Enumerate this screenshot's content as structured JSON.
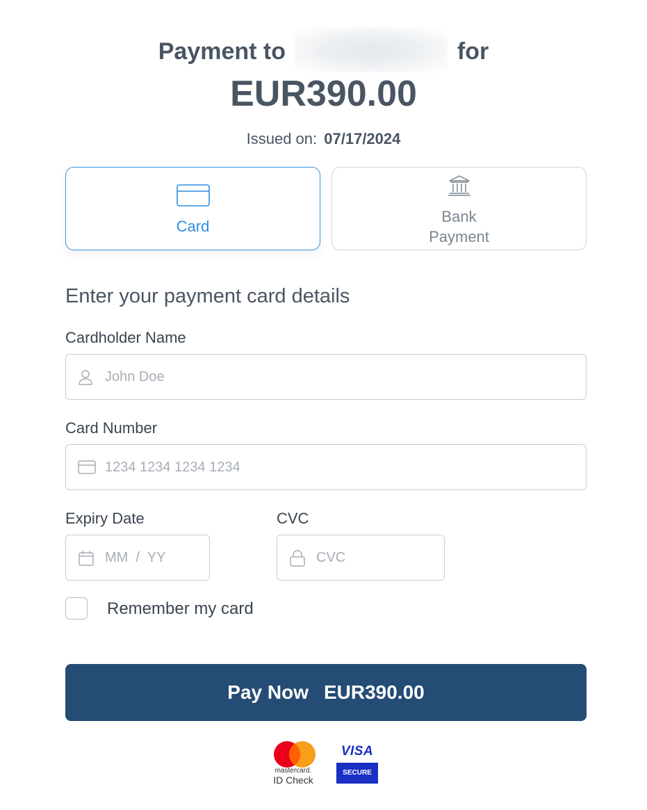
{
  "header": {
    "title_prefix": "Payment to",
    "title_suffix": "for",
    "amount": "EUR390.00",
    "issued_label": "Issued on:",
    "issued_date": "07/17/2024"
  },
  "payment_methods": {
    "card_label": "Card",
    "bank_label_line1": "Bank",
    "bank_label_line2": "Payment",
    "selected": "card"
  },
  "form": {
    "section_title": "Enter your payment card details",
    "cardholder_label": "Cardholder Name",
    "cardholder_placeholder": "John Doe",
    "card_number_label": "Card Number",
    "card_number_placeholder": "1234 1234 1234 1234",
    "expiry_label": "Expiry Date",
    "expiry_placeholder": "MM  /  YY",
    "cvc_label": "CVC",
    "cvc_placeholder": "CVC",
    "remember_label": "Remember my card",
    "remember_checked": false
  },
  "pay_button": {
    "label": "Pay Now",
    "amount": "EUR390.00"
  },
  "badges": {
    "mastercard_line1": "mastercard.",
    "mastercard_line2": "ID Check",
    "visa_word": "VISA",
    "visa_secure": "SECURE"
  },
  "colors": {
    "accent": "#3d95e0",
    "button_bg": "#244c74",
    "text": "#4a5563"
  }
}
